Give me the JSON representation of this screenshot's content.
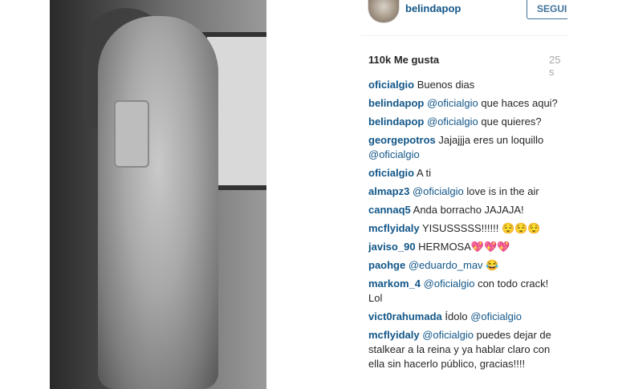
{
  "post": {
    "username": "belindapop",
    "follow_label": "SEGUIR",
    "likes": "110k Me gusta",
    "time": "25 s"
  },
  "comments": [
    {
      "user": "oficialgio",
      "mention": "",
      "text": "Buenos dias"
    },
    {
      "user": "belindapop",
      "mention": "@oficialgio",
      "text": "que haces aqui?"
    },
    {
      "user": "belindapop",
      "mention": "@oficialgio",
      "text": "que quieres?"
    },
    {
      "user": "georgepotros",
      "mention": "",
      "text": "Jajajjja eres un loquillo",
      "mention_after": "@oficialgio"
    },
    {
      "user": "oficialgio",
      "mention": "",
      "text": "A ti"
    },
    {
      "user": "almapz3",
      "mention": "@oficialgio",
      "text": "love is in the air"
    },
    {
      "user": "cannaq5",
      "mention": "",
      "text": "Anda borracho JAJAJA!"
    },
    {
      "user": "mcflyidaly",
      "mention": "",
      "text": "YISUSSSSS!!!!!! 😌😌😌"
    },
    {
      "user": "javiso_90",
      "mention": "",
      "text": "HERMOSA💖💖💖"
    },
    {
      "user": "paohge",
      "mention": "@eduardo_mav",
      "text": "😂"
    },
    {
      "user": "markom_4",
      "mention": "@oficialgio",
      "text": "con todo crack! Lol"
    },
    {
      "user": "vict0rahumada",
      "mention": "",
      "text": "Ídolo",
      "mention_after": "@oficialgio"
    },
    {
      "user": "mcflyidaly",
      "mention": "@oficialgio",
      "text": "puedes dejar de stalkear a la reina y ya hablar claro con ella sin hacerlo público, gracias!!!!"
    }
  ]
}
